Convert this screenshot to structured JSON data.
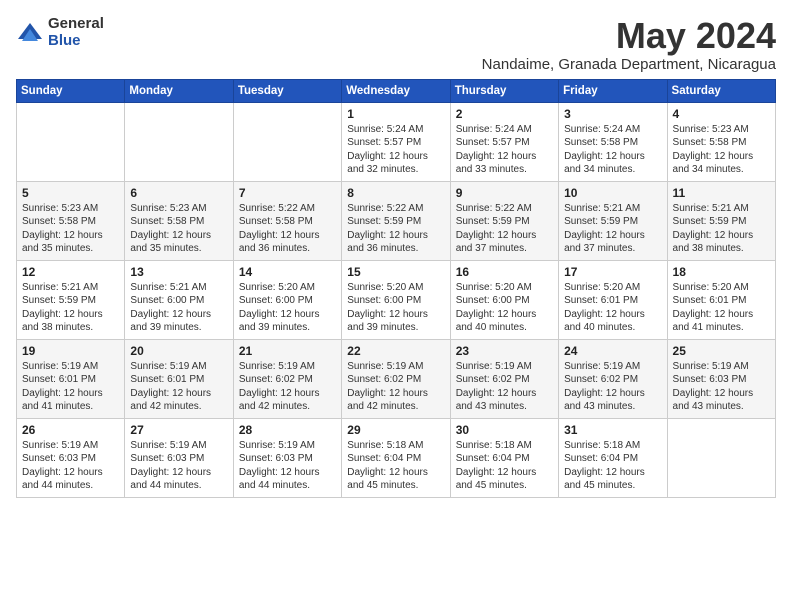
{
  "logo": {
    "general": "General",
    "blue": "Blue"
  },
  "title": {
    "month_year": "May 2024",
    "location": "Nandaime, Granada Department, Nicaragua"
  },
  "days_of_week": [
    "Sunday",
    "Monday",
    "Tuesday",
    "Wednesday",
    "Thursday",
    "Friday",
    "Saturday"
  ],
  "weeks": [
    [
      {
        "day": "",
        "info": ""
      },
      {
        "day": "",
        "info": ""
      },
      {
        "day": "",
        "info": ""
      },
      {
        "day": "1",
        "info": "Sunrise: 5:24 AM\nSunset: 5:57 PM\nDaylight: 12 hours\nand 32 minutes."
      },
      {
        "day": "2",
        "info": "Sunrise: 5:24 AM\nSunset: 5:57 PM\nDaylight: 12 hours\nand 33 minutes."
      },
      {
        "day": "3",
        "info": "Sunrise: 5:24 AM\nSunset: 5:58 PM\nDaylight: 12 hours\nand 34 minutes."
      },
      {
        "day": "4",
        "info": "Sunrise: 5:23 AM\nSunset: 5:58 PM\nDaylight: 12 hours\nand 34 minutes."
      }
    ],
    [
      {
        "day": "5",
        "info": "Sunrise: 5:23 AM\nSunset: 5:58 PM\nDaylight: 12 hours\nand 35 minutes."
      },
      {
        "day": "6",
        "info": "Sunrise: 5:23 AM\nSunset: 5:58 PM\nDaylight: 12 hours\nand 35 minutes."
      },
      {
        "day": "7",
        "info": "Sunrise: 5:22 AM\nSunset: 5:58 PM\nDaylight: 12 hours\nand 36 minutes."
      },
      {
        "day": "8",
        "info": "Sunrise: 5:22 AM\nSunset: 5:59 PM\nDaylight: 12 hours\nand 36 minutes."
      },
      {
        "day": "9",
        "info": "Sunrise: 5:22 AM\nSunset: 5:59 PM\nDaylight: 12 hours\nand 37 minutes."
      },
      {
        "day": "10",
        "info": "Sunrise: 5:21 AM\nSunset: 5:59 PM\nDaylight: 12 hours\nand 37 minutes."
      },
      {
        "day": "11",
        "info": "Sunrise: 5:21 AM\nSunset: 5:59 PM\nDaylight: 12 hours\nand 38 minutes."
      }
    ],
    [
      {
        "day": "12",
        "info": "Sunrise: 5:21 AM\nSunset: 5:59 PM\nDaylight: 12 hours\nand 38 minutes."
      },
      {
        "day": "13",
        "info": "Sunrise: 5:21 AM\nSunset: 6:00 PM\nDaylight: 12 hours\nand 39 minutes."
      },
      {
        "day": "14",
        "info": "Sunrise: 5:20 AM\nSunset: 6:00 PM\nDaylight: 12 hours\nand 39 minutes."
      },
      {
        "day": "15",
        "info": "Sunrise: 5:20 AM\nSunset: 6:00 PM\nDaylight: 12 hours\nand 39 minutes."
      },
      {
        "day": "16",
        "info": "Sunrise: 5:20 AM\nSunset: 6:00 PM\nDaylight: 12 hours\nand 40 minutes."
      },
      {
        "day": "17",
        "info": "Sunrise: 5:20 AM\nSunset: 6:01 PM\nDaylight: 12 hours\nand 40 minutes."
      },
      {
        "day": "18",
        "info": "Sunrise: 5:20 AM\nSunset: 6:01 PM\nDaylight: 12 hours\nand 41 minutes."
      }
    ],
    [
      {
        "day": "19",
        "info": "Sunrise: 5:19 AM\nSunset: 6:01 PM\nDaylight: 12 hours\nand 41 minutes."
      },
      {
        "day": "20",
        "info": "Sunrise: 5:19 AM\nSunset: 6:01 PM\nDaylight: 12 hours\nand 42 minutes."
      },
      {
        "day": "21",
        "info": "Sunrise: 5:19 AM\nSunset: 6:02 PM\nDaylight: 12 hours\nand 42 minutes."
      },
      {
        "day": "22",
        "info": "Sunrise: 5:19 AM\nSunset: 6:02 PM\nDaylight: 12 hours\nand 42 minutes."
      },
      {
        "day": "23",
        "info": "Sunrise: 5:19 AM\nSunset: 6:02 PM\nDaylight: 12 hours\nand 43 minutes."
      },
      {
        "day": "24",
        "info": "Sunrise: 5:19 AM\nSunset: 6:02 PM\nDaylight: 12 hours\nand 43 minutes."
      },
      {
        "day": "25",
        "info": "Sunrise: 5:19 AM\nSunset: 6:03 PM\nDaylight: 12 hours\nand 43 minutes."
      }
    ],
    [
      {
        "day": "26",
        "info": "Sunrise: 5:19 AM\nSunset: 6:03 PM\nDaylight: 12 hours\nand 44 minutes."
      },
      {
        "day": "27",
        "info": "Sunrise: 5:19 AM\nSunset: 6:03 PM\nDaylight: 12 hours\nand 44 minutes."
      },
      {
        "day": "28",
        "info": "Sunrise: 5:19 AM\nSunset: 6:03 PM\nDaylight: 12 hours\nand 44 minutes."
      },
      {
        "day": "29",
        "info": "Sunrise: 5:18 AM\nSunset: 6:04 PM\nDaylight: 12 hours\nand 45 minutes."
      },
      {
        "day": "30",
        "info": "Sunrise: 5:18 AM\nSunset: 6:04 PM\nDaylight: 12 hours\nand 45 minutes."
      },
      {
        "day": "31",
        "info": "Sunrise: 5:18 AM\nSunset: 6:04 PM\nDaylight: 12 hours\nand 45 minutes."
      },
      {
        "day": "",
        "info": ""
      }
    ]
  ]
}
